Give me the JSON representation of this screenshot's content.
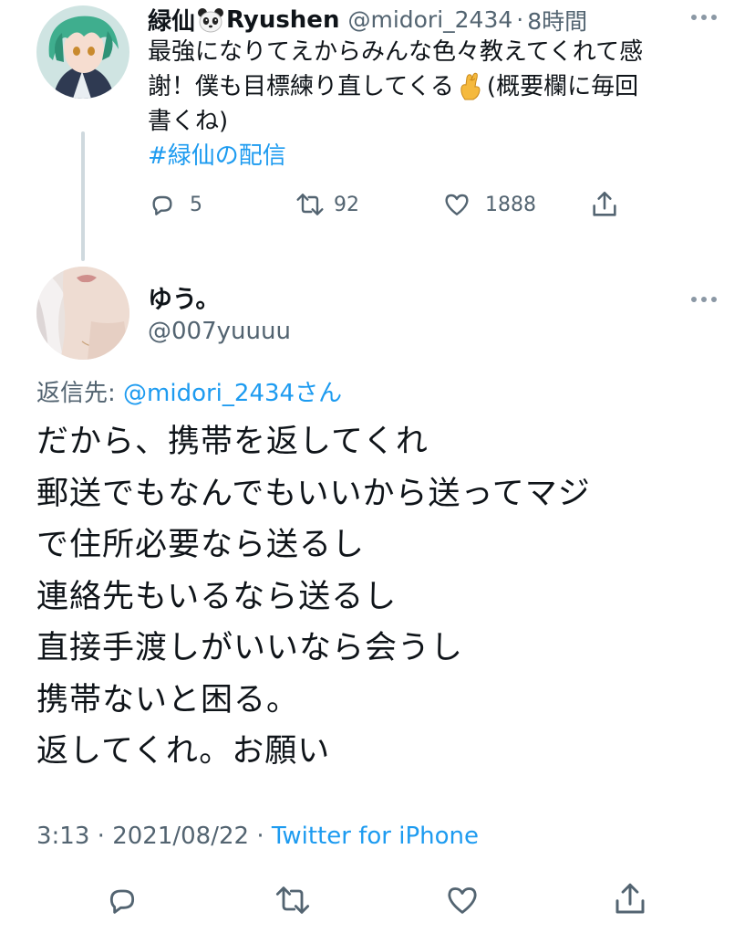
{
  "parent_tweet": {
    "display_name": "緑仙",
    "name_suffix": "Ryushen",
    "avatar_icon": "anime-character-avatar",
    "handle": "@midori_2434",
    "separator": "·",
    "time": "8時間",
    "text_lines": [
      "最強になりてえからみんな色々教えてくれて感",
      "謝！僕も目標練り直してくる",
      "書くね)"
    ],
    "text_after_emoji": "(概要欄に毎回",
    "emoji": "crossed-fingers-emoji",
    "hashtag": "#緑仙の配信",
    "reply_count": "5",
    "retweet_count": "92",
    "like_count": "1888"
  },
  "reply_tweet": {
    "display_name": "ゆう。",
    "handle": "@007yuuuu",
    "replying_to_label": "返信先:",
    "replying_to_handle": "@midori_2434さん",
    "text_lines": [
      "だから、携帯を返してくれ",
      "郵送でもなんでもいいから送ってマジ",
      "で住所必要なら送るし",
      "連絡先もいるなら送るし",
      "直接手渡しがいいなら会うし",
      "携帯ないと困る。",
      "返してくれ。お願い"
    ],
    "time": "3:13",
    "separator1": "·",
    "date": "2021/08/22",
    "separator2": "·",
    "source": "Twitter for iPhone"
  },
  "colors": {
    "accent": "#1d9bf0",
    "muted": "#536471",
    "text": "#0f1419"
  }
}
